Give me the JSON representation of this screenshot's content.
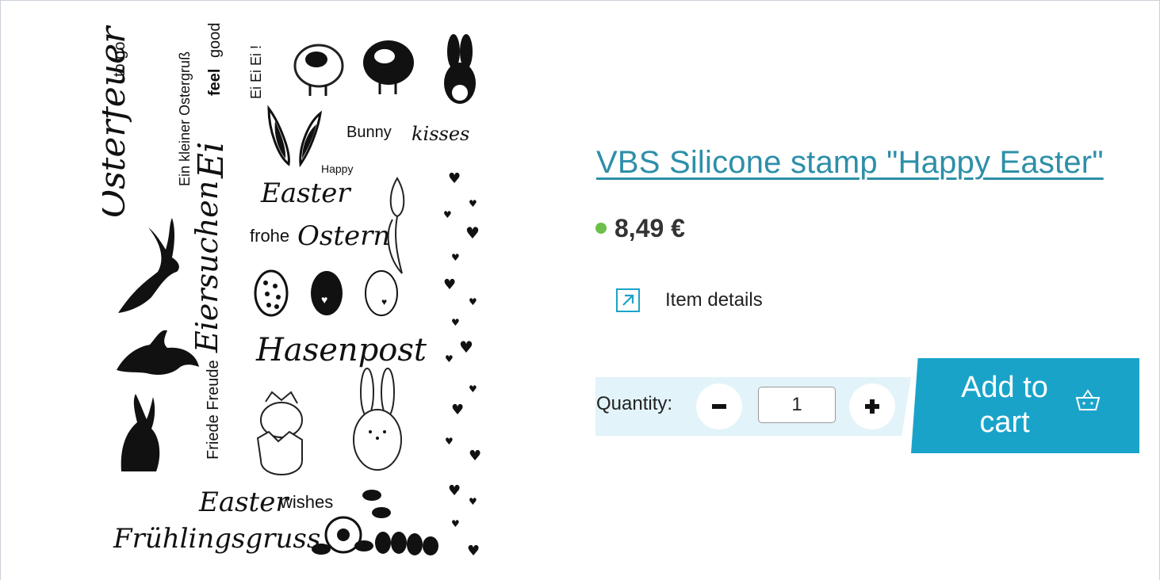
{
  "product": {
    "title": "VBS Silicone stamp \"Happy Easter\"",
    "price": "8,49 €",
    "availability_color": "#6cc04a",
    "details_label": "Item details",
    "details_icon": "external-link-arrow-icon",
    "quantity_label": "Quantity:",
    "quantity_value": "1",
    "minus_icon": "minus-icon",
    "plus_icon": "plus-icon",
    "add_to_cart_line1": "Add to",
    "add_to_cart_line2": "cart",
    "cart_icon": "shopping-basket-icon"
  },
  "stamp": {
    "words": {
      "osterfeuer_script": "Osterfeuer",
      "to_go": "to go",
      "ein_kleiner": "Ein kleiner Ostergruß",
      "ei_script": "Ei",
      "feel": "feel",
      "good": "good",
      "ei_ei_ei": "Ei Ei Ei !",
      "bunny": "Bunny",
      "kisses": "kisses",
      "happy": "Happy",
      "easter_script": "Easter",
      "frohe": "frohe",
      "ostern_script": "Ostern",
      "eiersuchen_script": "Eiersuchen",
      "hasenpost_script": "Hasenpost",
      "friede_freude": "Friede Freude",
      "easter_wishes_script": "Easter",
      "wishes": "wishes",
      "fruehlingsgruss_script": "Frühlingsgruss"
    },
    "colors": {
      "ink": "#111111",
      "outline": "#222222"
    }
  },
  "colors": {
    "accent": "#1aa3c9",
    "title": "#2d8fa8",
    "band": "#e2f3f9"
  }
}
